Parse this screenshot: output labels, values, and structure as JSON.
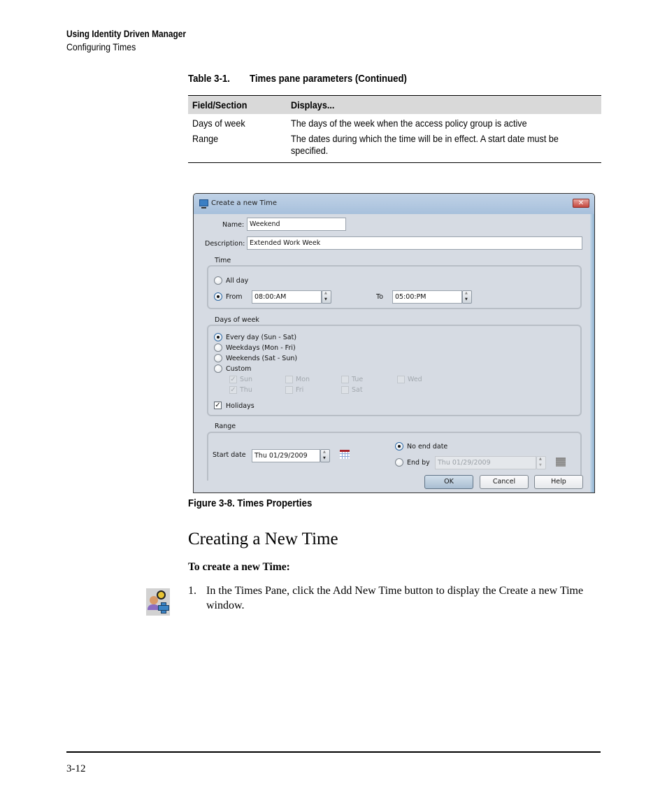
{
  "running_header": {
    "title": "Using Identity Driven Manager",
    "subtitle": "Configuring Times"
  },
  "table": {
    "caption_number": "Table 3-1.",
    "caption_title": "Times pane parameters (Continued)",
    "headers": [
      "Field/Section",
      "Displays..."
    ],
    "rows": [
      {
        "field": "Days of week",
        "displays": "The days of the week when the access policy group is active"
      },
      {
        "field": "Range",
        "displays_line1": "The dates during which the time will be in effect. A start date must be",
        "displays_line2": "specified."
      }
    ]
  },
  "dialog": {
    "title": "Create a new Time",
    "close_glyph": "✕",
    "name_label": "Name:",
    "name_value": "Weekend",
    "description_label": "Description:",
    "description_value": "Extended Work Week",
    "time": {
      "group_title": "Time",
      "all_day_label": "All day",
      "all_day_selected": false,
      "from_label": "From",
      "from_selected": true,
      "from_value": "08:00:AM",
      "to_label": "To",
      "to_value": "05:00:PM"
    },
    "days_of_week": {
      "group_title": "Days of week",
      "options": [
        {
          "label": "Every day (Sun - Sat)",
          "selected": true
        },
        {
          "label": "Weekdays (Mon - Fri)",
          "selected": false
        },
        {
          "label": "Weekends (Sat - Sun)",
          "selected": false
        },
        {
          "label": "Custom",
          "selected": false
        }
      ],
      "custom_days": [
        {
          "label": "Sun",
          "checked": true,
          "enabled": false
        },
        {
          "label": "Mon",
          "checked": false,
          "enabled": false
        },
        {
          "label": "Tue",
          "checked": false,
          "enabled": false
        },
        {
          "label": "Wed",
          "checked": false,
          "enabled": false
        },
        {
          "label": "Thu",
          "checked": true,
          "enabled": false
        },
        {
          "label": "Fri",
          "checked": false,
          "enabled": false
        },
        {
          "label": "Sat",
          "checked": false,
          "enabled": false
        }
      ],
      "holidays_label": "Holidays",
      "holidays_checked": true,
      "check_glyph": "✓"
    },
    "range": {
      "group_title": "Range",
      "start_date_label": "Start date",
      "start_date_value": "Thu  01/29/2009",
      "no_end_date_label": "No end date",
      "no_end_date_selected": true,
      "end_by_label": "End by",
      "end_by_selected": false,
      "end_by_value": "Thu  01/29/2009"
    },
    "buttons": {
      "ok": "OK",
      "cancel": "Cancel",
      "help": "Help"
    }
  },
  "figure_caption": "Figure 3-8. Times Properties",
  "section_heading": "Creating a New Time",
  "procedure_heading": "To create a new Time:",
  "steps": [
    {
      "number": "1.",
      "text": "In the Times Pane, click the Add New Time button to display the Create a new Time window."
    }
  ],
  "page_number": "3-12"
}
